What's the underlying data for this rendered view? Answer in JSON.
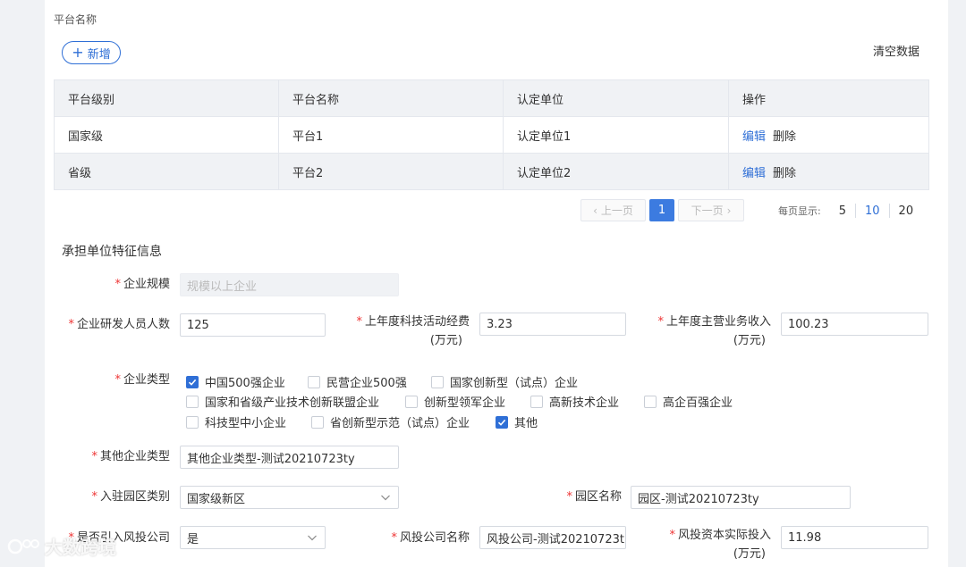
{
  "platform_section": {
    "label": "平台名称",
    "add_label": "新增",
    "clear_label": "清空数据",
    "table": {
      "headers": [
        "平台级别",
        "平台名称",
        "认定单位",
        "操作"
      ],
      "rows": [
        {
          "level": "国家级",
          "name": "平台1",
          "unit": "认定单位1",
          "edit": "编辑",
          "delete": "删除"
        },
        {
          "level": "省级",
          "name": "平台2",
          "unit": "认定单位2",
          "edit": "编辑",
          "delete": "删除"
        }
      ]
    },
    "pagination": {
      "prev": "上一页",
      "next": "下一页",
      "current": "1",
      "page_size_label": "每页显示:",
      "page_sizes": [
        "5",
        "10",
        "20"
      ],
      "active_size": "10"
    }
  },
  "feature_section": {
    "title": "承担单位特征信息",
    "scale": {
      "label": "企业规模",
      "value": "规模以上企业"
    },
    "rd_staff": {
      "label": "企业研发人员人数",
      "value": "125"
    },
    "tech_expense": {
      "label": "上年度科技活动经费",
      "unit": "(万元)",
      "value": "3.23"
    },
    "main_revenue": {
      "label": "上年度主营业务收入",
      "unit": "(万元)",
      "value": "100.23"
    },
    "enterprise_type": {
      "label": "企业类型",
      "options": [
        {
          "label": "中国500强企业",
          "checked": true
        },
        {
          "label": "民营企业500强",
          "checked": false
        },
        {
          "label": "国家创新型（试点）企业",
          "checked": false
        },
        {
          "label": "国家和省级产业技术创新联盟企业",
          "checked": false
        },
        {
          "label": "创新型领军企业",
          "checked": false
        },
        {
          "label": "高新技术企业",
          "checked": false
        },
        {
          "label": "高企百强企业",
          "checked": false
        },
        {
          "label": "科技型中小企业",
          "checked": false
        },
        {
          "label": "省创新型示范（试点）企业",
          "checked": false
        },
        {
          "label": "其他",
          "checked": true
        }
      ]
    },
    "other_type": {
      "label": "其他企业类型",
      "value": "其他企业类型-测试20210723ty"
    },
    "park_category": {
      "label": "入驻园区类别",
      "value": "国家级新区"
    },
    "park_name": {
      "label": "园区名称",
      "value": "园区-测试20210723ty"
    },
    "vc_introduced": {
      "label": "是否引入风投公司",
      "value": "是"
    },
    "vc_name": {
      "label": "风投公司名称",
      "value": "风投公司-测试20210723t"
    },
    "vc_investment": {
      "label": "风投资本实际投入",
      "unit": "(万元)",
      "value": "11.98"
    }
  },
  "watermark": {
    "text": "大数跨境"
  },
  "colors": {
    "accent": "#2f6fd6",
    "required": "#e33333",
    "header_bg": "#f0f2f5"
  }
}
